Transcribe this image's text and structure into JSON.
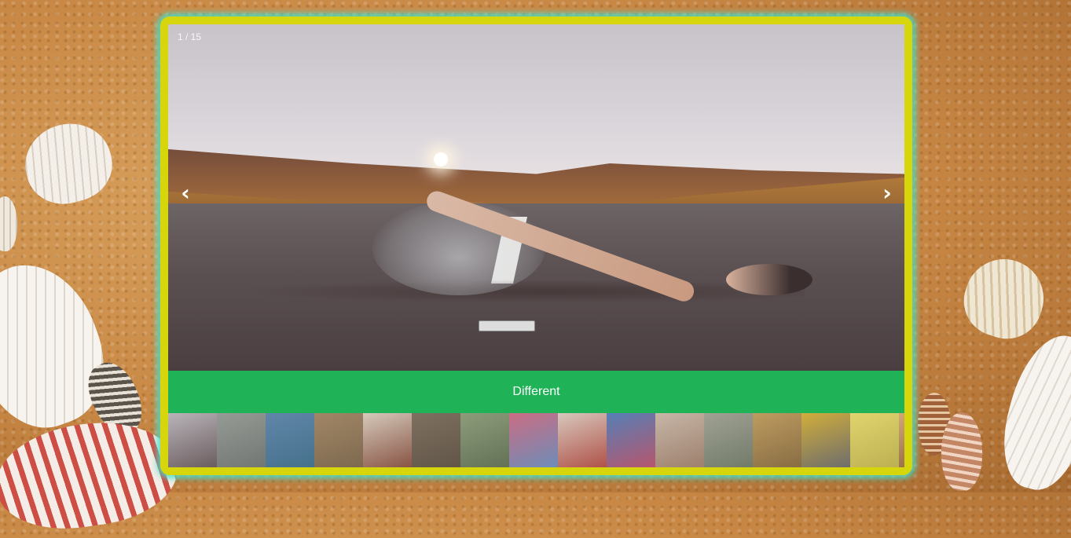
{
  "slider": {
    "counter": "1 / 15",
    "prev_glyph": "‹",
    "next_glyph": "›",
    "caption": "Different",
    "accent_frame": "#d7d60d",
    "accent_glow": "#40e0d0",
    "caption_bg": "#20b256"
  },
  "thumbnails": [
    {
      "name": "swimmer-road",
      "active": true,
      "colors": [
        "#b9b4b9",
        "#6b5d5f"
      ]
    },
    {
      "name": "foggy-landscape",
      "active": false,
      "colors": [
        "#9aa09a",
        "#6f7570"
      ]
    },
    {
      "name": "blue-waterfall",
      "active": false,
      "colors": [
        "#5b87b0",
        "#3b6f8e"
      ]
    },
    {
      "name": "cracked-earth-flower",
      "active": false,
      "colors": [
        "#a88862",
        "#7d6547"
      ]
    },
    {
      "name": "hourglass-drawing",
      "active": false,
      "colors": [
        "#e4d7c6",
        "#8a4c3a"
      ]
    },
    {
      "name": "chalk-writing",
      "active": false,
      "colors": [
        "#7e6e5a",
        "#5c4e3f"
      ]
    },
    {
      "name": "country-road",
      "active": false,
      "colors": [
        "#8fa27a",
        "#5e6f4f"
      ]
    },
    {
      "name": "colorful-burst",
      "active": false,
      "colors": [
        "#d86a84",
        "#6a8fc2"
      ]
    },
    {
      "name": "red-frame",
      "active": false,
      "colors": [
        "#e8d4c8",
        "#b84a3e"
      ]
    },
    {
      "name": "painted-wall-person",
      "active": false,
      "colors": [
        "#4f7fc0",
        "#c04f6a"
      ]
    },
    {
      "name": "woman-sketch",
      "active": false,
      "colors": [
        "#d4c0ae",
        "#a3806a"
      ]
    },
    {
      "name": "hands-sprout",
      "active": false,
      "colors": [
        "#a6a896",
        "#6f7a66"
      ]
    },
    {
      "name": "coffee-book",
      "active": false,
      "colors": [
        "#c9a15a",
        "#8a6a3a"
      ]
    },
    {
      "name": "yellow-umbrella",
      "active": false,
      "colors": [
        "#e0b62e",
        "#6a6a6a"
      ]
    },
    {
      "name": "smiley-balls",
      "active": false,
      "colors": [
        "#f0e36a",
        "#c7b94a"
      ]
    },
    {
      "name": "partial-next",
      "active": false,
      "colors": [
        "#e0b070",
        "#a07040"
      ]
    }
  ]
}
